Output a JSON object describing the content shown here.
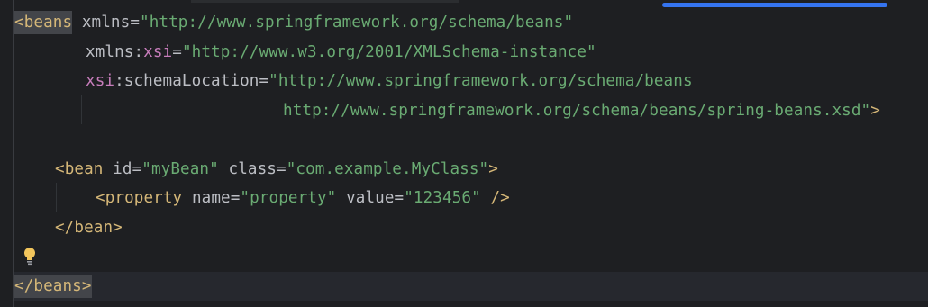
{
  "editor": {
    "language": "xml",
    "colors": {
      "background": "#1e1f22",
      "tag": "#d5b778",
      "attribute": "#bcbec4",
      "namespace": "#c77dbb",
      "string": "#6aab73",
      "current_line": "#26282e",
      "scroll_thumb": "#3574f0"
    },
    "lines": {
      "l1": {
        "open": "<beans",
        "attr": "xmlns",
        "eq": "=",
        "value": "\"http://www.springframework.org/schema/beans\""
      },
      "l2": {
        "attr": "xmlns:",
        "ns": "xsi",
        "eq": "=",
        "value": "\"http://www.w3.org/2001/XMLSchema-instance\""
      },
      "l3": {
        "ns": "xsi",
        "attr": ":schemaLocation",
        "eq": "=",
        "value": "\"http://www.springframework.org/schema/beans"
      },
      "l4": {
        "value": "http://www.springframework.org/schema/beans/spring-beans.xsd\"",
        "close": ">"
      },
      "l6": {
        "open": "<bean",
        "attr1": "id",
        "eq1": "=",
        "value1": "\"myBean\"",
        "attr2": "class",
        "eq2": "=",
        "value2": "\"com.example.MyClass\"",
        "close": ">"
      },
      "l7": {
        "open": "<property",
        "attr1": "name",
        "eq1": "=",
        "value1": "\"property\"",
        "attr2": "value",
        "eq2": "=",
        "value2": "\"123456\"",
        "close": "/>"
      },
      "l8": {
        "tag": "</bean>"
      },
      "l10": {
        "tag": "</beans>"
      }
    },
    "intention_icon": "lightbulb-icon"
  }
}
